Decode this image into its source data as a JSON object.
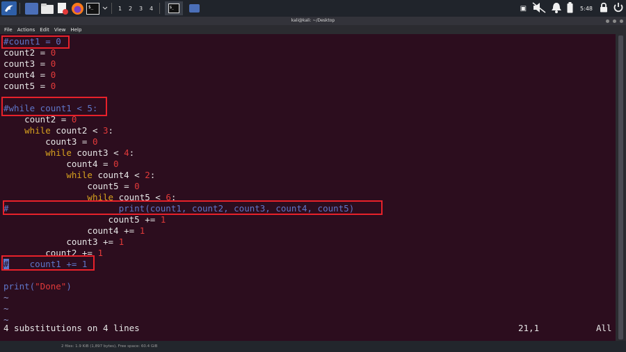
{
  "taskbar": {
    "workspaces": [
      "1",
      "2",
      "3",
      "4"
    ],
    "clock": "5:48"
  },
  "window": {
    "title": "kali@kali: ~/Desktop"
  },
  "menu": [
    "File",
    "Actions",
    "Edit",
    "View",
    "Help"
  ],
  "editor": {
    "lines": {
      "l1": {
        "code": "#count1 = 0"
      },
      "l2": {
        "name": "count2",
        "op": " = ",
        "value": "0"
      },
      "l3": {
        "name": "count3",
        "op": " = ",
        "value": "0"
      },
      "l4": {
        "name": "count4",
        "op": " = ",
        "value": "0"
      },
      "l5": {
        "name": "count5",
        "op": " = ",
        "value": "0"
      },
      "l7": {
        "code": "#while count1 < 5:"
      },
      "l8": {
        "indent": "    ",
        "name": "count2",
        "op": " = ",
        "value": "0"
      },
      "l9": {
        "indent": "    ",
        "kw": "while",
        "cond": " count2 < ",
        "value": "3",
        "end": ":"
      },
      "l10": {
        "indent": "        ",
        "name": "count3",
        "op": " = ",
        "value": "0"
      },
      "l11": {
        "indent": "        ",
        "kw": "while",
        "cond": " count3 < ",
        "value": "4",
        "end": ":"
      },
      "l12": {
        "indent": "            ",
        "name": "count4",
        "op": " = ",
        "value": "0"
      },
      "l13": {
        "indent": "            ",
        "kw": "while",
        "cond": " count4 < ",
        "value": "2",
        "end": ":"
      },
      "l14": {
        "indent": "                ",
        "name": "count5",
        "op": " = ",
        "value": "0"
      },
      "l15": {
        "indent": "                ",
        "kw": "while",
        "cond": " count5 < ",
        "value": "6",
        "end": ":"
      },
      "l16": {
        "hash": "#",
        "indent": "                     ",
        "code": "print(count1, count2, count3, count4, count5)"
      },
      "l17": {
        "indent": "                    ",
        "name": "count5",
        "op": " += ",
        "value": "1"
      },
      "l18": {
        "indent": "                ",
        "name": "count4",
        "op": " += ",
        "value": "1"
      },
      "l19": {
        "indent": "            ",
        "name": "count3",
        "op": " += ",
        "value": "1"
      },
      "l20": {
        "indent": "        ",
        "name": "count2",
        "op": " += ",
        "value": "1"
      },
      "l21": {
        "hash": "#",
        "indent": "    ",
        "code": "count1 += 1"
      },
      "l23": {
        "pre": "print(",
        "str": "\"Done\"",
        "post": ")"
      }
    },
    "tilde": "~",
    "status": {
      "message": "4 substitutions on 4 lines",
      "position": "21,1",
      "scroll": "All"
    }
  },
  "filemanager_status": "2 files: 1.9 KiB (1,897 bytes), Free space: 60.4 GiB",
  "colors": {
    "background": "#2c0d1e",
    "comment": "#5f76c9",
    "keyword": "#d8a21e",
    "number": "#e23a3a",
    "highlight_box": "#e8212a"
  }
}
